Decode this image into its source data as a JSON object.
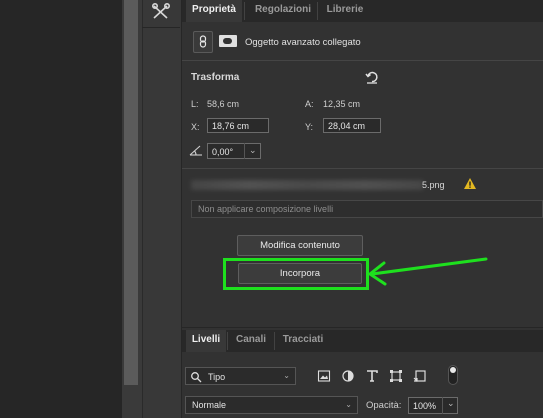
{
  "properties_panel": {
    "tabs": [
      {
        "label": "Proprietà"
      },
      {
        "label": "Regolazioni"
      },
      {
        "label": "Librerie"
      }
    ],
    "smart_object_label": "Oggetto avanzato collegato",
    "transform": {
      "title": "Trasforma",
      "l_label": "L:",
      "l_value": "58,6 cm",
      "a_label": "A:",
      "a_value": "12,35 cm",
      "x_label": "X:",
      "x_value": "18,76 cm",
      "y_label": "Y:",
      "y_value": "28,04 cm",
      "angle_value": "0,00°"
    },
    "file": {
      "name_suffix": "5.png"
    },
    "composition_placeholder": "Non applicare composizione livelli",
    "buttons": {
      "edit_contents": "Modifica contenuto",
      "embed": "Incorpora"
    },
    "highlight_color": "#1ee01e"
  },
  "layers_panel": {
    "tabs": [
      {
        "label": "Livelli"
      },
      {
        "label": "Canali"
      },
      {
        "label": "Tracciati"
      }
    ],
    "filter_kind": "Tipo",
    "blend_mode": "Normale",
    "opacity_label": "Opacità:",
    "opacity_value": "100%"
  }
}
